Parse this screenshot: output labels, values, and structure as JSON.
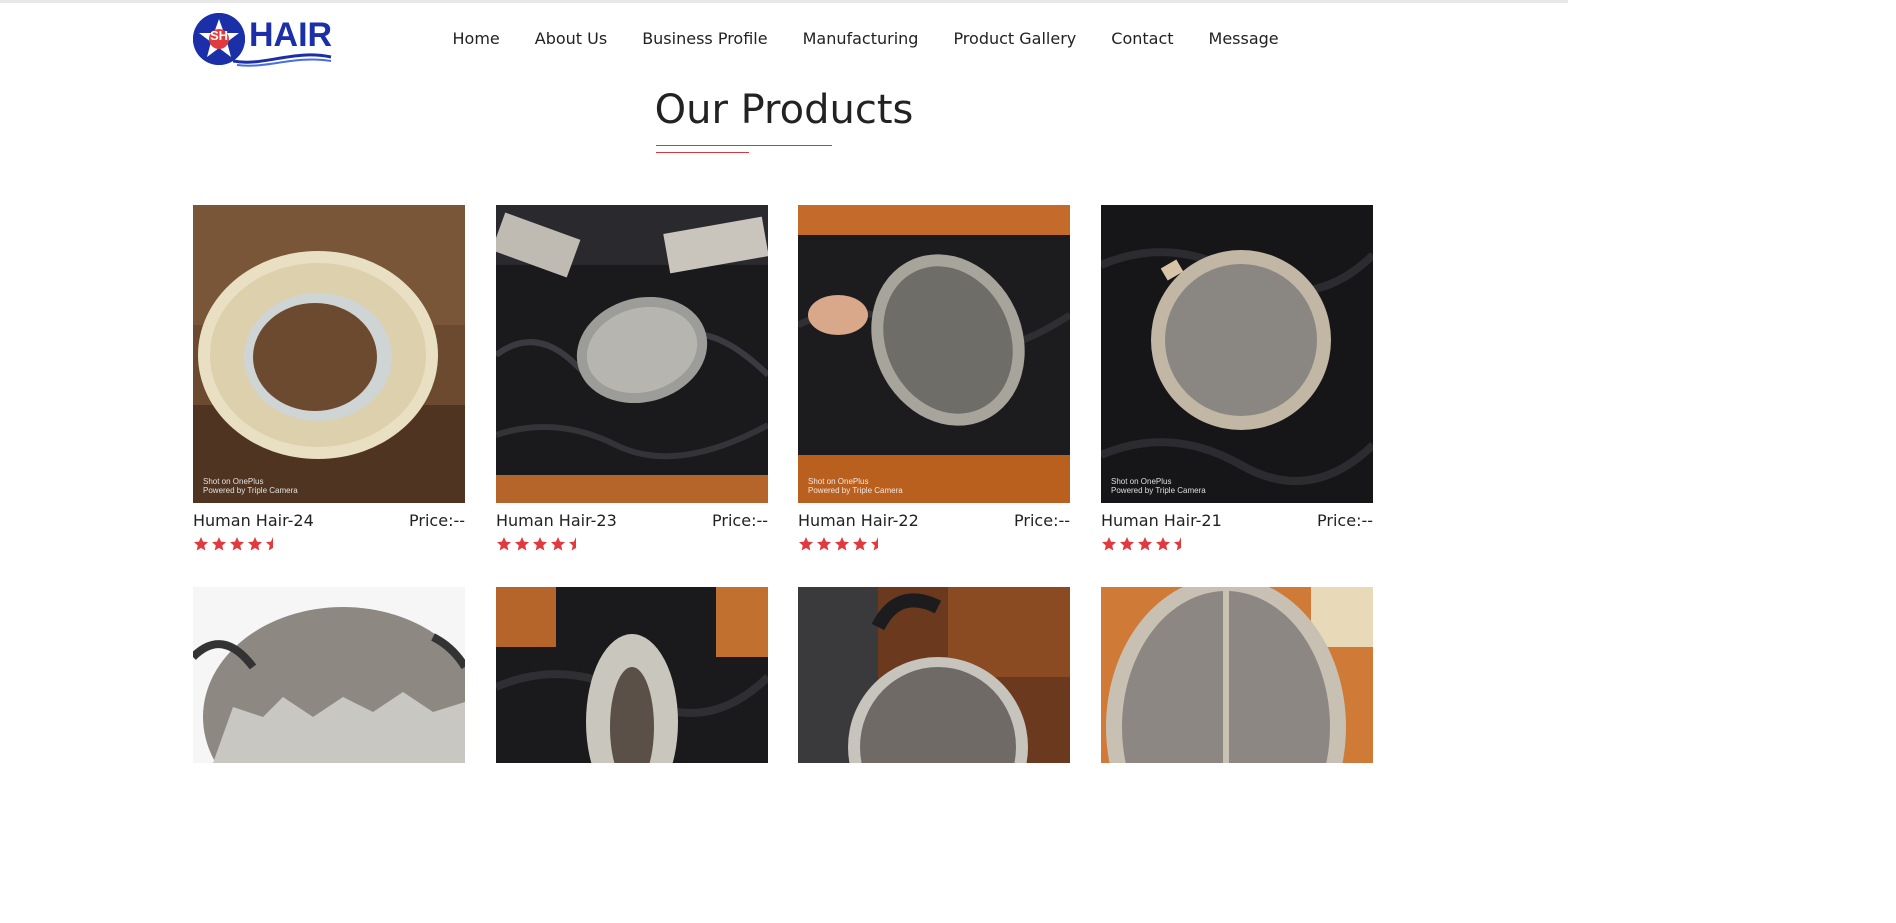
{
  "logo": {
    "badge_text": "SH",
    "word": "HAIR"
  },
  "nav": [
    "Home",
    "About Us",
    "Business Profile",
    "Manufacturing",
    "Product Gallery",
    "Contact",
    "Message"
  ],
  "section": {
    "title": "Our Products"
  },
  "products": [
    {
      "name": "Human Hair-24",
      "price": "Price:--",
      "rating": 4.5,
      "watermark_line1": "Shot on OnePlus",
      "watermark_line2": "Powered by Triple Camera"
    },
    {
      "name": "Human Hair-23",
      "price": "Price:--",
      "rating": 4.5
    },
    {
      "name": "Human Hair-22",
      "price": "Price:--",
      "rating": 4.5,
      "watermark_line1": "Shot on OnePlus",
      "watermark_line2": "Powered by Triple Camera"
    },
    {
      "name": "Human Hair-21",
      "price": "Price:--",
      "rating": 4.5,
      "watermark_line1": "Shot on OnePlus",
      "watermark_line2": "Powered by Triple Camera"
    }
  ],
  "colors": {
    "brand_blue": "#1b2fa8",
    "accent_red": "#d9363e",
    "star_red": "#e0393e"
  }
}
